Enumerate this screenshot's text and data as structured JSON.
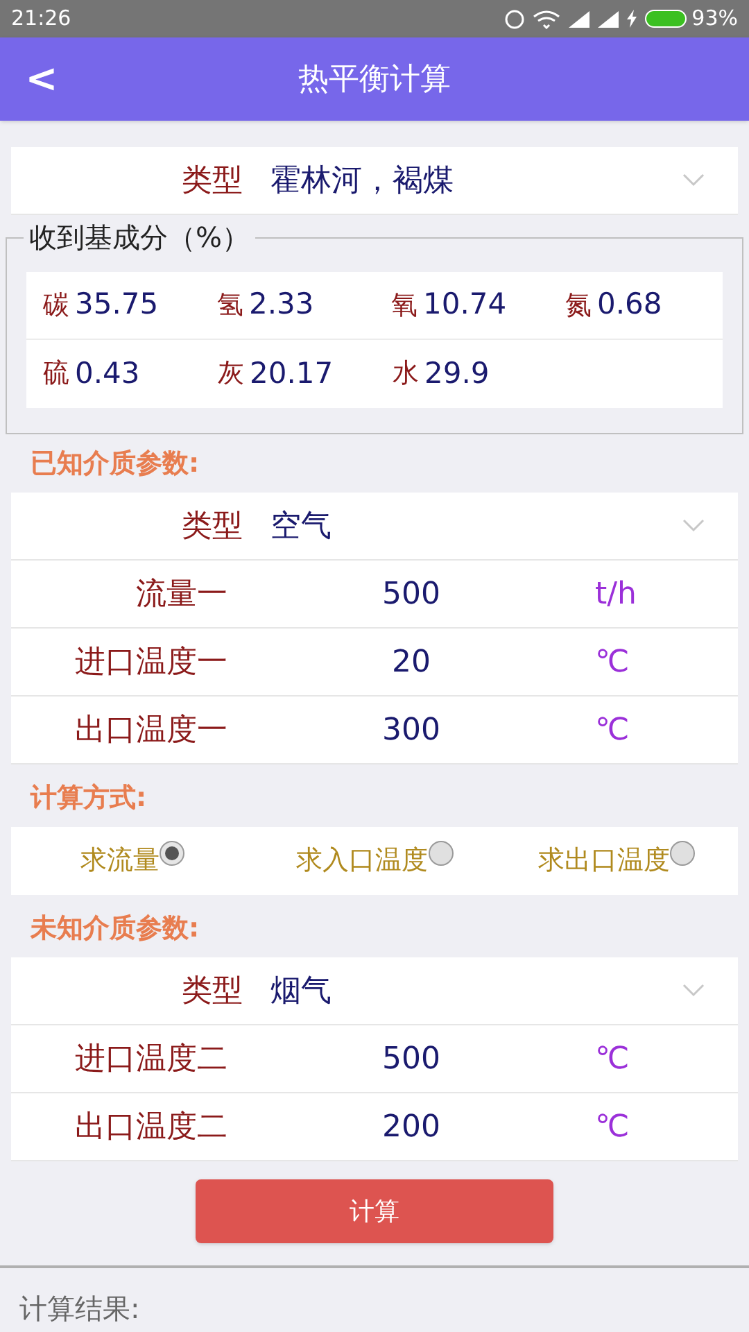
{
  "status_bar": {
    "time": "21:26",
    "battery": "93%"
  },
  "app_bar": {
    "back": "<",
    "title": "热平衡计算"
  },
  "fuel": {
    "type_label": "类型",
    "type_value": "霍林河，褐煤"
  },
  "composition": {
    "legend": "收到基成分（%）",
    "rows": [
      [
        {
          "label": "碳",
          "value": "35.75"
        },
        {
          "label": "氢",
          "value": "2.33"
        },
        {
          "label": "氧",
          "value": "10.74"
        },
        {
          "label": "氮",
          "value": "0.68"
        }
      ],
      [
        {
          "label": "硫",
          "value": "0.43"
        },
        {
          "label": "灰",
          "value": "20.17"
        },
        {
          "label": "水",
          "value": "29.9"
        }
      ]
    ]
  },
  "known": {
    "heading": "已知介质参数:",
    "type_label": "类型",
    "type_value": "空气",
    "rows": [
      {
        "label": "流量一",
        "value": "500",
        "unit": "t/h"
      },
      {
        "label": "进口温度一",
        "value": "20",
        "unit": "℃"
      },
      {
        "label": "出口温度一",
        "value": "300",
        "unit": "℃"
      }
    ]
  },
  "method": {
    "heading": "计算方式:",
    "options": [
      {
        "label": "求流量",
        "selected": true
      },
      {
        "label": "求入口温度",
        "selected": false
      },
      {
        "label": "求出口温度",
        "selected": false
      }
    ]
  },
  "unknown": {
    "heading": "未知介质参数:",
    "type_label": "类型",
    "type_value": "烟气",
    "rows": [
      {
        "label": "进口温度二",
        "value": "500",
        "unit": "℃"
      },
      {
        "label": "出口温度二",
        "value": "200",
        "unit": "℃"
      }
    ]
  },
  "calculate_button": "计算",
  "result": {
    "label": "计算结果:"
  }
}
